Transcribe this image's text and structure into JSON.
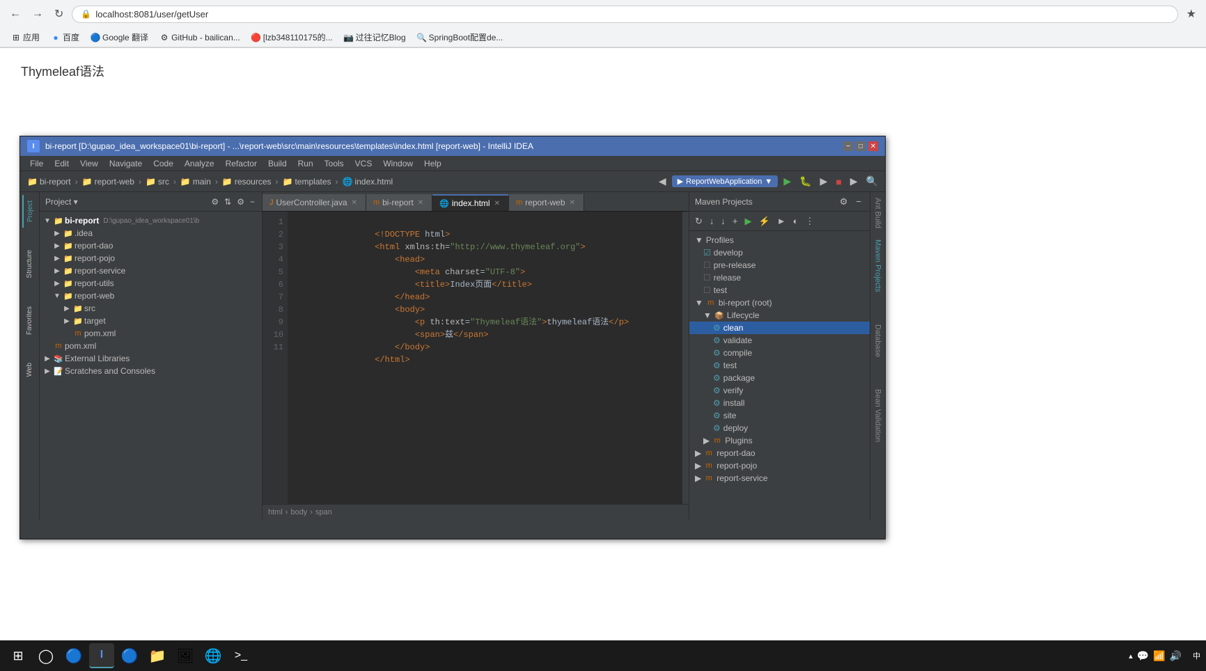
{
  "browser": {
    "url": "localhost:8081/user/getUser",
    "title": "Thymeleaf语法",
    "bookmarks": [
      {
        "label": "应用",
        "icon": "⊞"
      },
      {
        "label": "百度",
        "icon": "🔵"
      },
      {
        "label": "Google 翻译",
        "icon": "🔵"
      },
      {
        "label": "GitHub - bailican...",
        "icon": "⚙"
      },
      {
        "label": "[lzb348110175的...",
        "icon": "🔴"
      },
      {
        "label": "过往记忆Blog",
        "icon": "📷"
      },
      {
        "label": "SpringBoot配置de...",
        "icon": "🔍"
      }
    ]
  },
  "idea": {
    "title": "bi-report [D:\\gupao_idea_workspace01\\bi-report] - ...\\report-web\\src\\main\\resources\\templates\\index.html [report-web] - IntelliJ IDEA",
    "menus": [
      "File",
      "Edit",
      "View",
      "Navigate",
      "Code",
      "Analyze",
      "Refactor",
      "Build",
      "Run",
      "Tools",
      "VCS",
      "Window",
      "Help"
    ],
    "breadcrumb": [
      "bi-report",
      "report-web",
      "src",
      "main",
      "resources",
      "templates",
      "index.html"
    ],
    "run_config": "ReportWebApplication",
    "tabs": [
      {
        "label": "UserController.java",
        "active": false
      },
      {
        "label": "bi-report",
        "active": false
      },
      {
        "label": "index.html",
        "active": true
      },
      {
        "label": "report-web",
        "active": false
      }
    ],
    "project": {
      "title": "Project",
      "tree": [
        {
          "label": "bi-report",
          "indent": 0,
          "type": "folder",
          "expanded": true,
          "path": "D:\\gupao_idea_workspace01\\b"
        },
        {
          "label": ".idea",
          "indent": 1,
          "type": "folder",
          "expanded": false
        },
        {
          "label": "report-dao",
          "indent": 1,
          "type": "folder",
          "expanded": false
        },
        {
          "label": "report-pojo",
          "indent": 1,
          "type": "folder",
          "expanded": false
        },
        {
          "label": "report-service",
          "indent": 1,
          "type": "folder",
          "expanded": false
        },
        {
          "label": "report-utils",
          "indent": 1,
          "type": "folder",
          "expanded": false
        },
        {
          "label": "report-web",
          "indent": 1,
          "type": "folder",
          "expanded": true
        },
        {
          "label": "src",
          "indent": 2,
          "type": "folder",
          "expanded": false
        },
        {
          "label": "target",
          "indent": 2,
          "type": "folder-orange",
          "expanded": false
        },
        {
          "label": "pom.xml",
          "indent": 2,
          "type": "maven"
        },
        {
          "label": "pom.xml",
          "indent": 0,
          "type": "maven"
        },
        {
          "label": "External Libraries",
          "indent": 0,
          "type": "libs",
          "expanded": false
        },
        {
          "label": "Scratches and Consoles",
          "indent": 0,
          "type": "scratches",
          "expanded": false
        }
      ]
    },
    "code": [
      {
        "num": 1,
        "content": "    <!DOCTYPE html>"
      },
      {
        "num": 2,
        "content": "    <html xmlns:th=\"http://www.thymeleaf.org\">"
      },
      {
        "num": 3,
        "content": "        <head>"
      },
      {
        "num": 4,
        "content": "            <meta charset=\"UTF-8\">"
      },
      {
        "num": 5,
        "content": "            <title>Index页面</title>"
      },
      {
        "num": 6,
        "content": "        </head>"
      },
      {
        "num": 7,
        "content": "        <body>"
      },
      {
        "num": 8,
        "content": "            <p th:text=\"Thymeleaf语法\">thymeleaf语法</p>"
      },
      {
        "num": 9,
        "content": "            <span>兹</span>"
      },
      {
        "num": 10,
        "content": "        </body>"
      },
      {
        "num": 11,
        "content": "    </html>"
      }
    ],
    "breadcrumb_bottom": "html > body > span",
    "maven": {
      "title": "Maven Projects",
      "profiles": {
        "label": "Profiles",
        "items": [
          {
            "label": "develop",
            "checked": true
          },
          {
            "label": "pre-release",
            "checked": false
          },
          {
            "label": "release",
            "checked": false
          },
          {
            "label": "test",
            "checked": false
          }
        ]
      },
      "bi_report": {
        "label": "bi-report (root)",
        "lifecycle": {
          "label": "Lifecycle",
          "items": [
            {
              "label": "clean",
              "selected": true
            },
            {
              "label": "validate",
              "selected": false
            },
            {
              "label": "compile",
              "selected": false
            },
            {
              "label": "test",
              "selected": false
            },
            {
              "label": "package",
              "selected": false
            },
            {
              "label": "verify",
              "selected": false
            },
            {
              "label": "install",
              "selected": false
            },
            {
              "label": "site",
              "selected": false
            },
            {
              "label": "deploy",
              "selected": false
            }
          ]
        },
        "plugins": {
          "label": "Plugins"
        },
        "sub_modules": [
          "report-dao",
          "report-pojo",
          "report-service"
        ]
      }
    }
  },
  "taskbar": {
    "start_icon": "⊞",
    "icons": [
      "⊙",
      "🔵",
      "💻",
      "🔵",
      "📁",
      "🖼",
      "🌐"
    ],
    "clock": "中",
    "tray_items": [
      "▲",
      "💬",
      "📶",
      "🔊"
    ]
  }
}
